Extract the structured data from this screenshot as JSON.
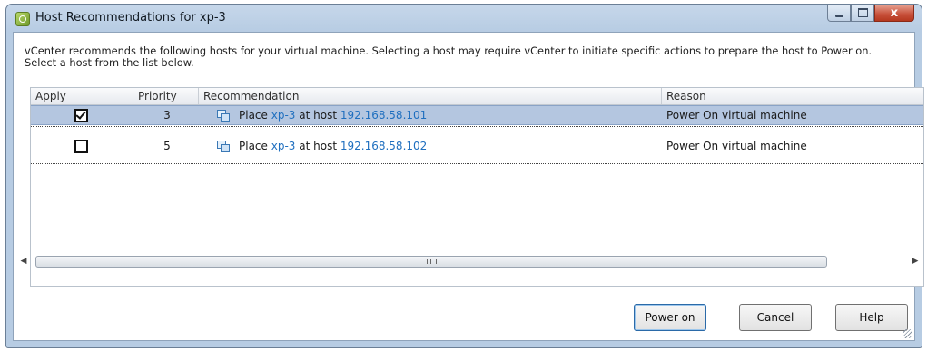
{
  "window": {
    "title": "Host Recommendations for xp-3",
    "close_glyph": "x"
  },
  "description": "vCenter recommends the following hosts for your virtual machine. Selecting a host may require vCenter to initiate specific actions to prepare the host to Power on. Select a host from the list below.",
  "table": {
    "columns": [
      "Apply",
      "Priority",
      "Recommendation",
      "Reason"
    ],
    "rows": [
      {
        "checked": true,
        "priority": "3",
        "action": "Place",
        "vm": "xp-3",
        "connector": "at host",
        "host": "192.168.58.101",
        "reason": "Power On virtual machine",
        "selected": true
      },
      {
        "checked": false,
        "priority": "5",
        "action": "Place",
        "vm": "xp-3",
        "connector": "at host",
        "host": "192.168.58.102",
        "reason": "Power On virtual machine",
        "selected": false
      }
    ],
    "row_icon": "vm-place-icon"
  },
  "scrollbar": {
    "grip_glyph": "III"
  },
  "buttons": {
    "power_on": "Power on",
    "cancel": "Cancel",
    "help": "Help"
  },
  "colors": {
    "selected_row": "#b4c6e0",
    "link": "#1f6fbf",
    "titlebar": "#c6d7ea"
  }
}
